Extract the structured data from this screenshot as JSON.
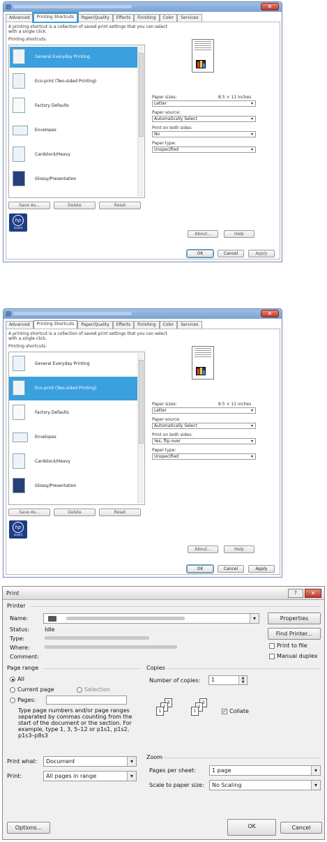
{
  "dialog1": {
    "tabs": [
      "Advanced",
      "Printing Shortcuts",
      "Paper/Quality",
      "Effects",
      "Finishing",
      "Color",
      "Services"
    ],
    "description": "A printing shortcut is a collection of saved print settings that you can select with a single click.",
    "shortcuts_label": "Printing shortcuts:",
    "items": [
      "General Everyday Printing",
      "Eco-print (Two-sided Printing)",
      "Factory Defaults",
      "Envelopes",
      "Cardstock/Heavy",
      "Glossy/Presentation"
    ],
    "buttons": {
      "save_as": "Save As...",
      "delete": "Delete",
      "reset": "Reset"
    },
    "paper_sizes_label": "Paper sizes:",
    "paper_sizes_dim": "8.5 × 11 inches",
    "paper_sizes_value": "Letter",
    "paper_source_label": "Paper source:",
    "paper_source_value": "Automatically Select",
    "print_both_label": "Print on both sides:",
    "print_both_value": "No",
    "paper_type_label": "Paper type:",
    "paper_type_value": "Unspecified",
    "about": "About...",
    "help": "Help",
    "ok": "OK",
    "cancel": "Cancel",
    "apply": "Apply",
    "logo_text": "hp",
    "logo_sub": "invent"
  },
  "dialog2": {
    "print_both_value": "Yes, flip over"
  },
  "print": {
    "title": "Print",
    "help_glyph": "?",
    "close_glyph": "✕",
    "printer_group": "Printer",
    "name_label": "Name:",
    "status_label": "Status:",
    "status_value": "Idle",
    "type_label": "Type:",
    "where_label": "Where:",
    "comment_label": "Comment:",
    "properties": "Properties",
    "find_printer": "Find Printer...",
    "print_to_file": "Print to file",
    "manual_duplex": "Manual duplex",
    "page_range": "Page range",
    "all": "All",
    "current_page": "Current page",
    "selection": "Selection",
    "pages": "Pages:",
    "pages_help": "Type page numbers and/or page ranges separated by commas counting from the start of the document or the section. For example, type 1, 3, 5–12 or p1s1, p1s2, p1s3–p8s3",
    "copies_group": "Copies",
    "number_of_copies": "Number of copies:",
    "copies_value": "1",
    "collate": "Collate",
    "print_what_label": "Print what:",
    "print_what_value": "Document",
    "print_label": "Print:",
    "print_value": "All pages in range",
    "zoom_group": "Zoom",
    "pages_per_sheet_label": "Pages per sheet:",
    "pages_per_sheet_value": "1 page",
    "scale_label": "Scale to paper size:",
    "scale_value": "No Scaling",
    "options": "Options...",
    "ok": "OK",
    "cancel": "Cancel"
  },
  "colors": {
    "accent": "#3aa0de",
    "hp_blue": "#1d3e86"
  }
}
